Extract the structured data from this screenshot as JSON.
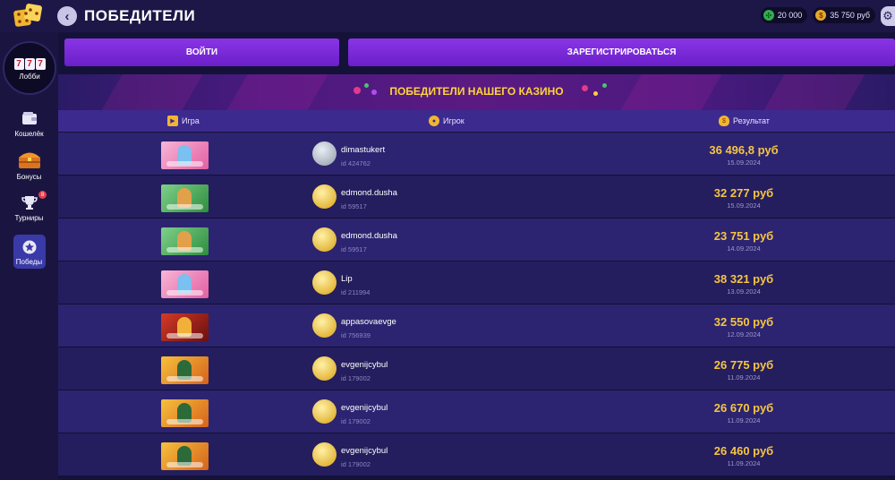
{
  "header": {
    "title": "ПОБЕДИТЕЛИ",
    "balance_bonus": "20 000",
    "balance_money": "35 750 руб"
  },
  "sidebar": {
    "lobby_label": "Лобби",
    "lobby_slots": [
      "7",
      "7",
      "7"
    ],
    "items": [
      {
        "label": "Кошелёк",
        "icon": "wallet-icon"
      },
      {
        "label": "Бонусы",
        "icon": "chest-icon"
      },
      {
        "label": "Турниры",
        "icon": "trophy-icon",
        "badge": "8"
      },
      {
        "label": "Победы",
        "icon": "star-icon",
        "active": true
      }
    ]
  },
  "auth": {
    "login_label": "ВОЙТИ",
    "register_label": "ЗАРЕГИСТРИРОВАТЬСЯ"
  },
  "banner": {
    "title": "ПОБЕДИТЕЛИ НАШЕГО КАЗИНО"
  },
  "table": {
    "columns": [
      "Игра",
      "Игрок",
      "Результат"
    ],
    "rows": [
      {
        "game_theme": "pink",
        "avatar": "silver",
        "player": "dimastukert",
        "player_id": "id 424762",
        "amount": "36 496,8 руб",
        "date": "15.09.2024"
      },
      {
        "game_theme": "green",
        "avatar": "gold",
        "player": "edmond.dusha",
        "player_id": "id 59517",
        "amount": "32 277 руб",
        "date": "15.09.2024"
      },
      {
        "game_theme": "green",
        "avatar": "gold",
        "player": "edmond.dusha",
        "player_id": "id 59517",
        "amount": "23 751 руб",
        "date": "14.09.2024"
      },
      {
        "game_theme": "pink",
        "avatar": "gold",
        "player": "Lip",
        "player_id": "id 211994",
        "amount": "38 321 руб",
        "date": "13.09.2024"
      },
      {
        "game_theme": "red",
        "avatar": "gold",
        "player": "appasovaevge",
        "player_id": "id 756939",
        "amount": "32 550 руб",
        "date": "12.09.2024"
      },
      {
        "game_theme": "orange",
        "avatar": "gold",
        "player": "evgenijcybul",
        "player_id": "id 179002",
        "amount": "26 775 руб",
        "date": "11.09.2024"
      },
      {
        "game_theme": "orange",
        "avatar": "gold",
        "player": "evgenijcybul",
        "player_id": "id 179002",
        "amount": "26 670 руб",
        "date": "11.09.2024"
      },
      {
        "game_theme": "orange",
        "avatar": "gold",
        "player": "evgenijcybul",
        "player_id": "id 179002",
        "amount": "26 460 руб",
        "date": "11.09.2024"
      }
    ]
  },
  "colors": {
    "accent_purple": "#7a2be0",
    "gold_text": "#f6c543",
    "banner_title": "#ffd33a"
  }
}
